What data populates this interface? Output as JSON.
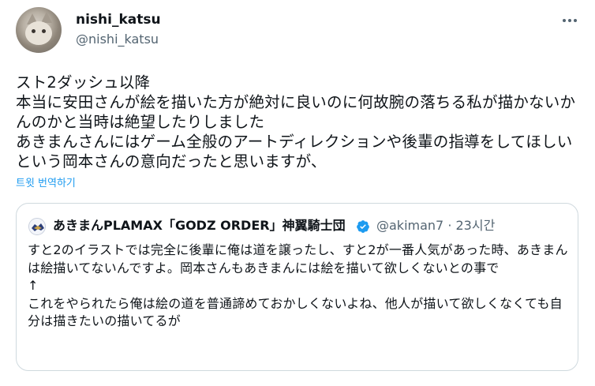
{
  "author": {
    "display_name": "nishi_katsu",
    "handle": "@nishi_katsu"
  },
  "tweet": {
    "text": "スト2ダッシュ以降\n本当に安田さんが絵を描いた方が絶対に良いのに何故腕の落ちる私が描かないかんのかと当時は絶望したりしました\nあきまんさんにはゲーム全般のアートディレクションや後輩の指導をしてほしいという岡本さんの意向だったと思いますが、",
    "translate_label": "트윗 번역하기"
  },
  "quoted_tweet": {
    "display_name": "あきまんPLAMAX「GODZ ORDER」神翼騎士団",
    "handle_time": "@akiman7 · 23시간",
    "text": "すと2のイラストでは完全に後輩に俺は道を譲ったし、すと2が一番人気があった時、あきまんは絵描いてないんですよ。岡本さんもあきまんには絵を描いて欲しくないとの事で\n↑\nこれをやられたら俺は絵の道を普通諦めておかしくないよね、他人が描いて欲しくなくても自分は描きたいの描いてるが"
  },
  "icons": {
    "more": "more-horizontal-icon",
    "verified": "verified-badge-icon"
  },
  "colors": {
    "link": "#1d9bf0",
    "secondary_text": "#536471",
    "border": "#cfd9de",
    "verified": "#1d9bf0"
  }
}
